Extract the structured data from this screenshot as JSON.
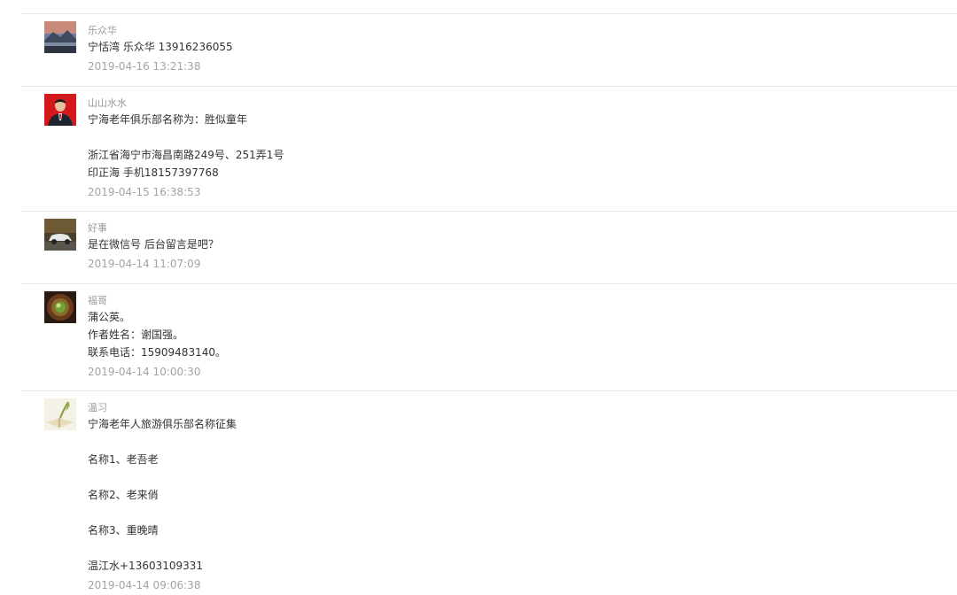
{
  "comments": [
    {
      "author": "乐众华",
      "avatar_icon": "landscape-photo-icon",
      "lines": [
        "宁恬湾 乐众华 13916236055"
      ],
      "time": "2019-04-16 13:21:38"
    },
    {
      "author": "山山水水",
      "avatar_icon": "person-portrait-icon",
      "lines": [
        "宁海老年俱乐部名称为：胜似童年",
        "浙江省海宁市海昌南路249号、251弄1号",
        "印正海 手机18157397768"
      ],
      "time": "2019-04-15 16:38:53"
    },
    {
      "author": "好事",
      "avatar_icon": "car-photo-icon",
      "lines": [
        "是在微信号 后台留言是吧？"
      ],
      "time": "2019-04-14 11:07:09"
    },
    {
      "author": "福哥",
      "avatar_icon": "flower-photo-icon",
      "lines": [
        "蒲公英。",
        "作者姓名：谢国强。",
        "联系电话：15909483140。"
      ],
      "time": "2019-04-14 10:00:30"
    },
    {
      "author": "温习",
      "avatar_icon": "book-quill-icon",
      "lines": [
        "宁海老年人旅游俱乐部名称征集",
        "名称1、老吾老",
        "名称2、老来俏",
        "名称3、重晚晴",
        "温江水+13603109331"
      ],
      "time": "2019-04-14 09:06:38"
    }
  ],
  "colors": {
    "separator": "#e8e8e8",
    "author": "#9a9a9a",
    "text": "#333333",
    "time": "#a3a3a3"
  }
}
